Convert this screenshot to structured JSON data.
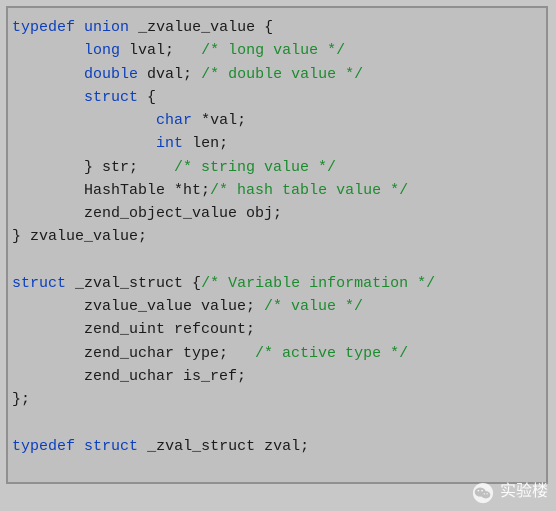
{
  "code": {
    "l1": {
      "kw1": "typedef",
      "sp1": " ",
      "kw2": "union",
      "sp2": " ",
      "id": "_zvalue_value {"
    },
    "l2": {
      "pad": "        ",
      "kw": "long",
      "sp": " ",
      "id": "lval;   ",
      "cm": "/* long value */"
    },
    "l3": {
      "pad": "        ",
      "kw": "double",
      "sp": " ",
      "id": "dval; ",
      "cm": "/* double value */"
    },
    "l4": {
      "pad": "        ",
      "kw": "struct",
      "sp": " ",
      "id": "{"
    },
    "l5": {
      "pad": "                ",
      "kw": "char",
      "sp": " ",
      "id": "*val;"
    },
    "l6": {
      "pad": "                ",
      "kw": "int",
      "sp": " ",
      "id": "len;"
    },
    "l7": {
      "pad": "        ",
      "id": "} str;    ",
      "cm": "/* string value */"
    },
    "l8": {
      "pad": "        ",
      "id": "HashTable *ht;",
      "cm": "/* hash table value */"
    },
    "l9": {
      "pad": "        ",
      "id": "zend_object_value obj;"
    },
    "l10": {
      "id": "} zvalue_value;"
    },
    "l12": {
      "kw": "struct",
      "sp": " ",
      "id": "_zval_struct {",
      "cm": "/* Variable information */"
    },
    "l13": {
      "pad": "        ",
      "id": "zvalue_value value; ",
      "cm": "/* value */"
    },
    "l14": {
      "pad": "        ",
      "id": "zend_uint refcount;"
    },
    "l15": {
      "pad": "        ",
      "id": "zend_uchar type;   ",
      "cm": "/* active type */"
    },
    "l16": {
      "pad": "        ",
      "id": "zend_uchar is_ref;"
    },
    "l17": {
      "id": "};"
    },
    "l19": {
      "kw1": "typedef",
      "sp1": " ",
      "kw2": "struct",
      "sp2": " ",
      "id": "_zval_struct zval;"
    }
  },
  "watermark": {
    "text": "实验楼"
  }
}
